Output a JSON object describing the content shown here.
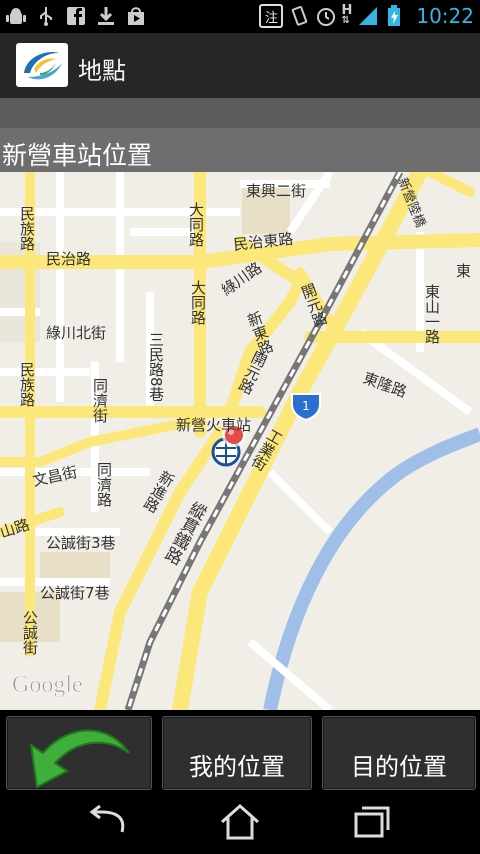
{
  "status_bar": {
    "left_icons": [
      "android-debug-icon",
      "usb-icon",
      "facebook-icon",
      "download-icon",
      "play-store-icon"
    ],
    "notice_badge": "注",
    "network_type": "H",
    "time": "10:22"
  },
  "title_bar": {
    "title": "地點"
  },
  "sub_header": {
    "station_title": "新營車站位置"
  },
  "map": {
    "watermark": "Google",
    "labels": {
      "dongxing2": "東興二街",
      "xinying_bridge": "新營陸橋",
      "minzu": "民族路",
      "datong_top": "大同路",
      "minzhi_w": "民治路",
      "minzhi_e": "民治東路",
      "dong": "東",
      "lvchuan": "綠川路",
      "kaiyuan_top": "開元路",
      "dongshan1": "東山一路",
      "lvchuan_n": "綠川北街",
      "sanmin8": "三民路8巷",
      "datong_mid": "大同路",
      "xindong": "新東路",
      "kaiyuan_mid": "開元路",
      "donglong": "東隆路",
      "minzu_mid": "民族路",
      "tongji_top": "同濟街",
      "route1": "1",
      "station": "新營火車站",
      "gongye": "工業街",
      "wenchang": "文昌街",
      "tongji_mid": "同濟路",
      "xinjin": "新進路",
      "shan": "山路",
      "zonguan": "縱貫鐵路",
      "gongcheng3": "公誠街3巷",
      "gongcheng7": "公誠街7巷",
      "gongcheng": "公誠街"
    }
  },
  "bottom_bar": {
    "back_button": "back-arrow-icon",
    "my_location": "我的位置",
    "destination": "目的位置"
  },
  "nav_bar": {
    "icons": [
      "back-icon",
      "home-icon",
      "recent-apps-icon"
    ]
  },
  "colors": {
    "clock": "#33b5e5",
    "road_major": "#fbe77a",
    "road_minor": "#ffffff",
    "river": "#9fbfe9",
    "marker": "#e14b48"
  }
}
